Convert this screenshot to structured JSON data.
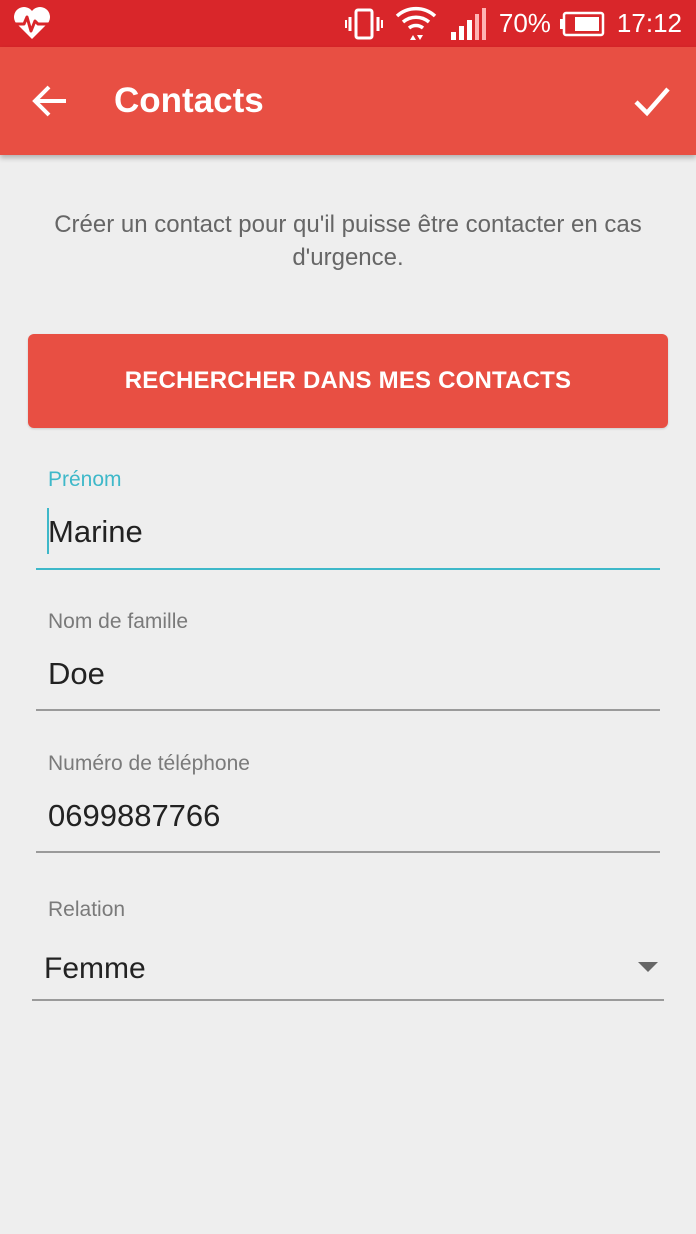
{
  "status_bar": {
    "battery": "70%",
    "time": "17:12",
    "color": "#d9262a"
  },
  "app_bar": {
    "title": "Contacts",
    "back_icon": "arrow-back-icon",
    "confirm_icon": "check-icon",
    "color": "#e84f43"
  },
  "intro_text": "Créer un contact pour qu'il puisse être contacter en cas d'urgence.",
  "search_button": {
    "label": "RECHERCHER DANS MES CONTACTS"
  },
  "form": {
    "first_name": {
      "label": "Prénom",
      "value": "Marine",
      "focused": true
    },
    "last_name": {
      "label": "Nom de famille",
      "value": "Doe"
    },
    "phone": {
      "label": "Numéro de téléphone",
      "value": "0699887766"
    },
    "relation": {
      "label": "Relation",
      "value": "Femme"
    }
  },
  "accent_color": "#3eb8c9"
}
